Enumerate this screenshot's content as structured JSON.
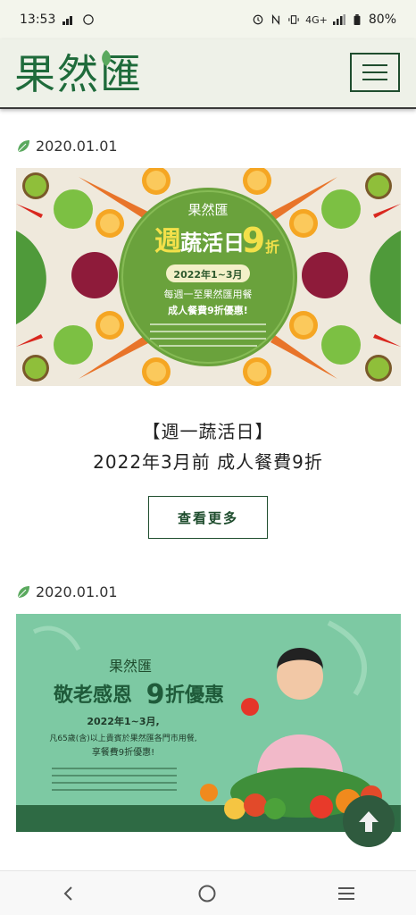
{
  "status_bar": {
    "time": "13:53",
    "network": "4G+",
    "battery": "80%"
  },
  "header": {
    "logo_text": "果然匯",
    "menu_icon": "hamburger-menu-icon"
  },
  "posts": [
    {
      "date": "2020.01.01",
      "banner": {
        "brand": "果然匯",
        "headline_a": "週",
        "headline_b": "蔬活日",
        "headline_c": "9",
        "headline_d": "折",
        "period": "2022年1~3月",
        "line1": "每週一至果然匯用餐",
        "line2": "成人餐費9折優惠!"
      },
      "title_line1": "【週一蔬活日】",
      "title_line2": "2022年3月前 成人餐費9折",
      "more_label": "查看更多"
    },
    {
      "date": "2020.01.01",
      "banner": {
        "brand": "果然匯",
        "headline": "敬老感恩",
        "headline_num": "9",
        "headline_tail": "折優惠",
        "period": "2022年1~3月,",
        "line1": "凡65歲(含)以上貴賓於果然匯各門市用餐,",
        "line2": "享餐費9折優惠!"
      }
    }
  ],
  "scroll_top_icon": "arrow-up-icon",
  "nav_bar": {
    "back_icon": "back-chevron-icon",
    "home_icon": "home-circle-icon",
    "recents_icon": "recents-lines-icon"
  },
  "colors": {
    "brand_green": "#1f6b3b",
    "dark_green": "#2f5a3e",
    "banner2_bg": "#7dc9a3"
  }
}
